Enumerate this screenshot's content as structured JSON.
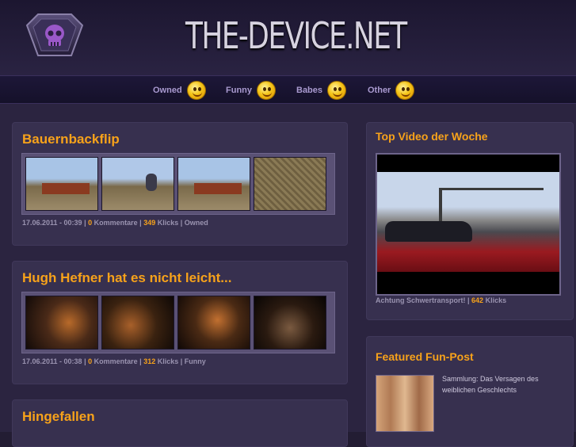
{
  "header": {
    "site_title": "THE-DEVICE.NET",
    "logo_icon": "skull-shield-icon"
  },
  "nav": {
    "items": [
      {
        "label": "Owned",
        "icon": "smiley-blush-icon"
      },
      {
        "label": "Funny",
        "icon": "smiley-grin-icon"
      },
      {
        "label": "Babes",
        "icon": "smiley-love-icon"
      },
      {
        "label": "Other",
        "icon": "smiley-wink-icon"
      }
    ]
  },
  "posts": [
    {
      "title": "Bauernbackflip",
      "date": "17.06.2011 - 00:39",
      "comments": "0",
      "comments_label": "Kommentare",
      "clicks": "349",
      "clicks_label": "Klicks",
      "category": "Owned"
    },
    {
      "title": "Hugh Hefner hat es nicht leicht...",
      "date": "17.06.2011 - 00:38",
      "comments": "0",
      "comments_label": "Kommentare",
      "clicks": "312",
      "clicks_label": "Klicks",
      "category": "Funny"
    },
    {
      "title": "Hingefallen"
    }
  ],
  "sidebar": {
    "top_video": {
      "heading": "Top Video der Woche",
      "caption": "Achtung Schwertransport!",
      "clicks": "642",
      "clicks_label": "Klicks"
    },
    "featured": {
      "heading": "Featured Fun-Post",
      "text": "Sammlung: Das Versagen des weiblichen Geschlechts"
    }
  },
  "colors": {
    "accent": "#f7a21a",
    "background": "#2b2440",
    "card": "#37304f",
    "nav_text": "#a99ad0"
  }
}
